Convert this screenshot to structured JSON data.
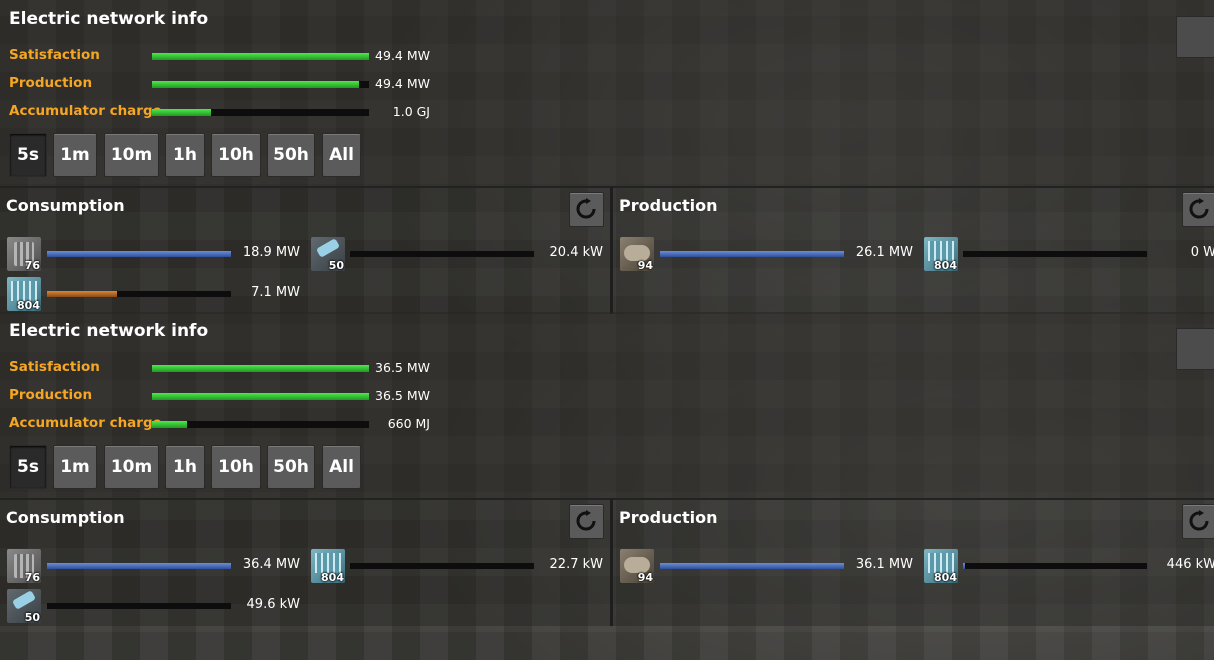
{
  "panels": [
    {
      "title": "Electric network info",
      "stats": [
        {
          "label": "Satisfaction",
          "fill": 1.0,
          "value": "49.4 MW"
        },
        {
          "label": "Production",
          "fill": 0.955,
          "value": "49.4 MW"
        },
        {
          "label": "Accumulator charge",
          "fill": 0.27,
          "value": "1.0 GJ"
        }
      ],
      "time_buttons": [
        "5s",
        "1m",
        "10m",
        "1h",
        "10h",
        "50h",
        "All"
      ],
      "active_time": "5s",
      "consumption": {
        "title": "Consumption",
        "entries": [
          {
            "icon": "accumulator-icon",
            "count": "76",
            "fill": 1.0,
            "color": "blue",
            "value": "18.9 MW"
          },
          {
            "icon": "roboport-icon",
            "count": "50",
            "fill": 0.0,
            "color": "blue",
            "value": "20.4 kW"
          },
          {
            "icon": "solar-panel-icon",
            "count": "804",
            "fill": 0.38,
            "color": "orange",
            "value": "7.1 MW"
          }
        ]
      },
      "production": {
        "title": "Production",
        "entries": [
          {
            "icon": "steam-engine-icon",
            "count": "94",
            "fill": 1.0,
            "color": "blue",
            "value": "26.1 MW"
          },
          {
            "icon": "solar-panel-icon",
            "count": "804",
            "fill": 0.0,
            "color": "blue",
            "value": "0 W"
          }
        ]
      }
    },
    {
      "title": "Electric network info",
      "stats": [
        {
          "label": "Satisfaction",
          "fill": 1.0,
          "value": "36.5 MW"
        },
        {
          "label": "Production",
          "fill": 1.0,
          "value": "36.5 MW"
        },
        {
          "label": "Accumulator charge",
          "fill": 0.16,
          "value": "660 MJ"
        }
      ],
      "time_buttons": [
        "5s",
        "1m",
        "10m",
        "1h",
        "10h",
        "50h",
        "All"
      ],
      "active_time": "5s",
      "consumption": {
        "title": "Consumption",
        "entries": [
          {
            "icon": "accumulator-icon",
            "count": "76",
            "fill": 1.0,
            "color": "blue",
            "value": "36.4 MW"
          },
          {
            "icon": "solar-panel-icon",
            "count": "804",
            "fill": 0.0,
            "color": "blue",
            "value": "22.7 kW"
          },
          {
            "icon": "roboport-icon",
            "count": "50",
            "fill": 0.0,
            "color": "blue",
            "value": "49.6 kW"
          }
        ]
      },
      "production": {
        "title": "Production",
        "entries": [
          {
            "icon": "steam-engine-icon",
            "count": "94",
            "fill": 1.0,
            "color": "blue",
            "value": "36.1 MW"
          },
          {
            "icon": "solar-panel-icon",
            "count": "804",
            "fill": 0.01,
            "color": "blue",
            "value": "446 kW"
          }
        ]
      }
    }
  ],
  "colors": {
    "label_orange": "#f5a623",
    "bar_green": "#2fbf2f",
    "bar_blue": "#3f63b8",
    "bar_orange": "#b0661f"
  }
}
